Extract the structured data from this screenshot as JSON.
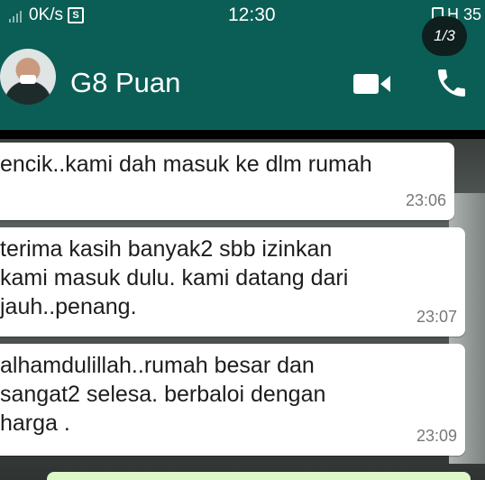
{
  "status_bar": {
    "network_speed": "0K/s",
    "time": "12:30",
    "right_text": "H 35"
  },
  "page_counter": "1/3",
  "header": {
    "contact_name": "G8 Puan"
  },
  "messages": [
    {
      "text_lines": [
        "encik..kami dah masuk ke dlm rumah"
      ],
      "time": "23:06"
    },
    {
      "text_lines": [
        "terima kasih banyak2 sbb izinkan",
        "kami masuk dulu. kami datang dari",
        "jauh..penang."
      ],
      "time": "23:07"
    },
    {
      "text_lines": [
        "alhamdulillah..rumah besar dan",
        "sangat2 selesa. berbaloi dengan",
        "harga ."
      ],
      "time": "23:09"
    }
  ],
  "colors": {
    "header": "#0b5e55",
    "incoming_bubble": "#ffffff",
    "outgoing_bubble": "#dcf8c6"
  }
}
